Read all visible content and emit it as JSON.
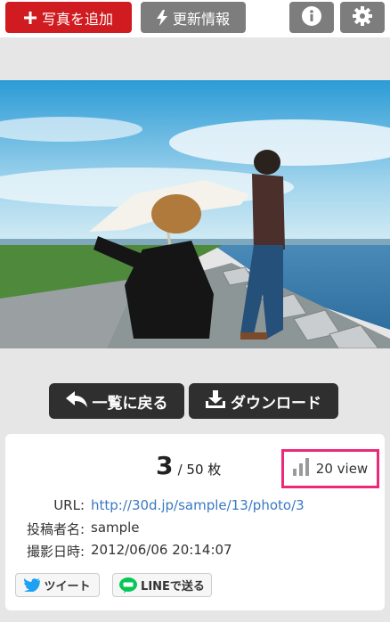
{
  "header": {
    "add_photo_label": "写真を追加",
    "updates_label": "更新情報"
  },
  "nav": {
    "back_label": "一覧に戻る",
    "download_label": "ダウンロード"
  },
  "photo_info": {
    "index": "3",
    "total": "/ 50 枚",
    "views": "20 view",
    "url_label": "URL:",
    "url": "http://30d.jp/sample/13/photo/3",
    "poster_label": "投稿者名:",
    "poster": "sample",
    "date_label": "撮影日時:",
    "date": "2012/06/06 20:14:07"
  },
  "share": {
    "tweet_label": "ツイート",
    "line_label": "LINEで送る"
  },
  "colors": {
    "add_button": "#d01c20",
    "grey_button": "#7d7d7d",
    "dark_button": "#2f2f2f",
    "views_highlight": "#ea2a78",
    "link": "#3a78c3",
    "twitter": "#1da1f2",
    "line": "#06c755"
  },
  "icons": [
    "plus-icon",
    "lightning-icon",
    "info-icon",
    "gear-icon",
    "back-arrow-icon",
    "download-icon",
    "bar-chart-icon",
    "twitter-bird-icon",
    "line-icon"
  ]
}
